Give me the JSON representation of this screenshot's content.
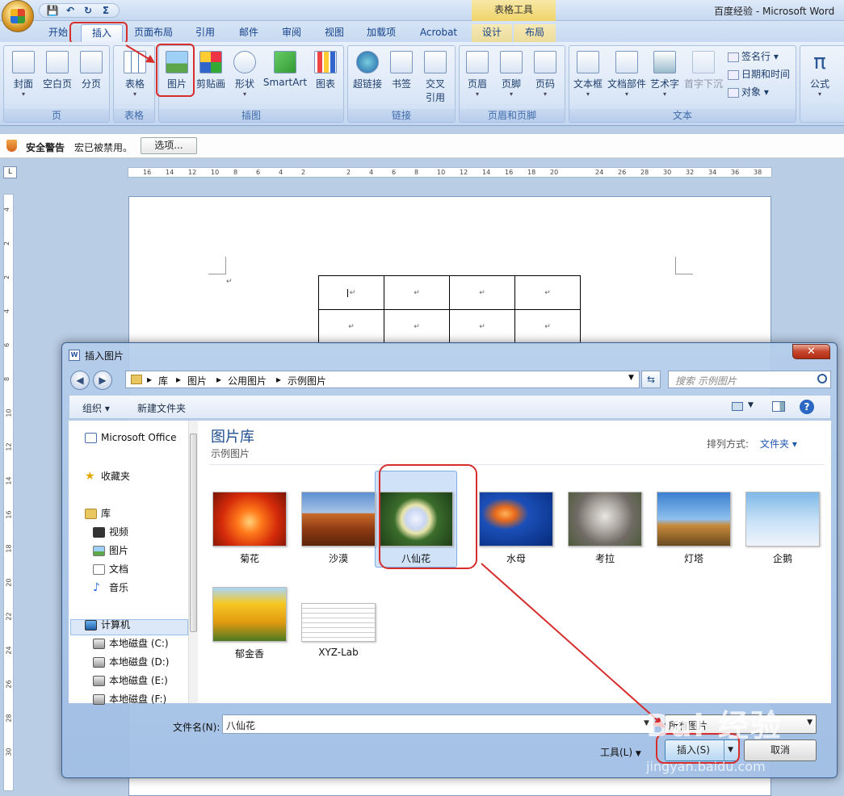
{
  "window": {
    "title": "百度经验 - Microsoft Word",
    "contextual_title": "表格工具",
    "qat": {
      "save": "💾",
      "undo": "↶",
      "redo": "↻",
      "sigma": "Σ"
    }
  },
  "tabs": [
    "开始",
    "插入",
    "页面布局",
    "引用",
    "邮件",
    "审阅",
    "视图",
    "加载项",
    "Acrobat",
    "设计",
    "布局"
  ],
  "ribbon": {
    "groups": {
      "page": "页",
      "table": "表格",
      "illustrations": "插图",
      "links": "链接",
      "header_footer": "页眉和页脚",
      "text": "文本"
    },
    "buttons": {
      "cover": "封面",
      "blank": "空白页",
      "break": "分页",
      "table": "表格",
      "picture": "图片",
      "clipart": "剪贴画",
      "shapes": "形状",
      "smartart": "SmartArt",
      "chart": "图表",
      "hyperlink": "超链接",
      "bookmark": "书签",
      "crossref_1": "交叉",
      "crossref_2": "引用",
      "header": "页眉",
      "footer": "页脚",
      "pagenum": "页码",
      "textbox": "文本框",
      "quickparts": "文档部件",
      "wordart": "艺术字",
      "dropcap": "首字下沉",
      "signature": "签名行",
      "datetime": "日期和时间",
      "object": "对象",
      "equation": "公式"
    }
  },
  "security_bar": {
    "title": "安全警告",
    "message": "宏已被禁用。",
    "options": "选项..."
  },
  "ruler": {
    "corner": "L",
    "h_ticks": [
      "16",
      "14",
      "12",
      "10",
      "8",
      "6",
      "4",
      "2",
      "2",
      "4",
      "6",
      "8",
      "10",
      "12",
      "14",
      "16",
      "18",
      "20",
      "24",
      "26",
      "28",
      "30",
      "32",
      "34",
      "36",
      "38"
    ],
    "v_ticks": [
      "4",
      "2",
      "2",
      "4",
      "6",
      "8",
      "10",
      "12",
      "14",
      "16",
      "18",
      "20",
      "22",
      "24",
      "26",
      "28",
      "30"
    ]
  },
  "document": {
    "cell_mark": "↵",
    "para_mark": "↵"
  },
  "dialog": {
    "title": "插入图片",
    "close": "✕",
    "breadcrumbs": [
      "库",
      "图片",
      "公用图片",
      "示例图片"
    ],
    "search_placeholder": "搜索 示例图片",
    "toolbar": {
      "organize": "组织 ▾",
      "new_folder": "新建文件夹"
    },
    "nav": {
      "office": "Microsoft Office",
      "favorites": "收藏夹",
      "libraries": "库",
      "videos": "视频",
      "pictures": "图片",
      "documents": "文档",
      "music": "音乐",
      "computer": "计算机",
      "drives": [
        "本地磁盘 (C:)",
        "本地磁盘 (D:)",
        "本地磁盘 (E:)",
        "本地磁盘 (F:)"
      ]
    },
    "library": {
      "title": "图片库",
      "subtitle": "示例图片",
      "sort_label": "排列方式:",
      "sort_value": "文件夹 ▾"
    },
    "thumbnails": [
      "菊花",
      "沙漠",
      "八仙花",
      "水母",
      "考拉",
      "灯塔",
      "企鹅",
      "郁金香",
      "XYZ-Lab"
    ],
    "filename_label": "文件名(N):",
    "filename_value": "八仙花",
    "filetype_value": "所有图片",
    "tools": "工具(L)",
    "insert": "插入(S)",
    "cancel": "取消"
  },
  "watermark": {
    "main": "Bai 经验",
    "sub": "jingyan.baidu.com"
  },
  "colors": {
    "annotation_red": "#d62d2d",
    "ribbon_blue": "#15428b"
  }
}
